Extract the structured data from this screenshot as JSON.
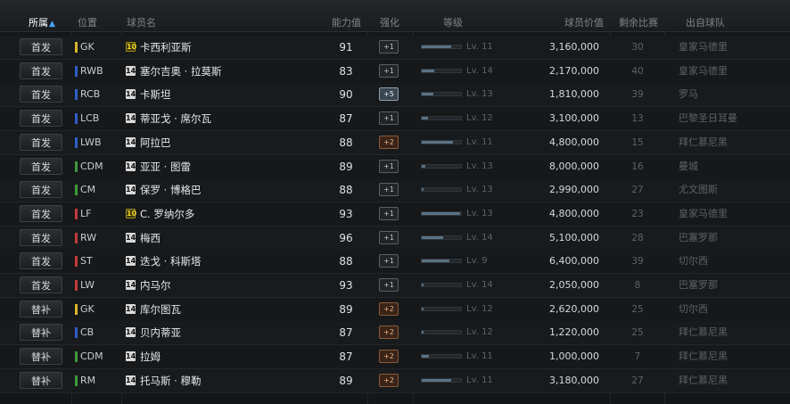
{
  "header": {
    "role": "所属",
    "position": "位置",
    "name": "球员名",
    "ability": "能力值",
    "enhance": "强化",
    "level": "等级",
    "value": "球员价值",
    "remaining": "剩余比赛",
    "team": "出自球队"
  },
  "rows": [
    {
      "role": "首发",
      "pos": "GK",
      "pos_color": "#d9b42a",
      "badge": "10",
      "name": "卡西利亚斯",
      "ability": "91",
      "enh": "+1",
      "enh_style": "grey",
      "lv_progress": 0.75,
      "level": "Lv. 11",
      "value": "3,160,000",
      "remaining": "30",
      "team": "皇家马德里"
    },
    {
      "role": "首发",
      "pos": "RWB",
      "pos_color": "#2f5fc9",
      "badge": "14",
      "name": "塞尔吉奥 · 拉莫斯",
      "ability": "83",
      "enh": "+1",
      "enh_style": "grey",
      "lv_progress": 0.32,
      "level": "Lv. 14",
      "value": "2,170,000",
      "remaining": "40",
      "team": "皇家马德里"
    },
    {
      "role": "首发",
      "pos": "RCB",
      "pos_color": "#2f5fc9",
      "badge": "14",
      "name": "卡斯坦",
      "ability": "90",
      "enh": "+5",
      "enh_style": "blue",
      "lv_progress": 0.3,
      "level": "Lv. 13",
      "value": "1,810,000",
      "remaining": "39",
      "team": "罗马"
    },
    {
      "role": "首发",
      "pos": "LCB",
      "pos_color": "#2f5fc9",
      "badge": "14",
      "name": "蒂亚戈 · 席尔瓦",
      "ability": "87",
      "enh": "+1",
      "enh_style": "grey",
      "lv_progress": 0.15,
      "level": "Lv. 12",
      "value": "3,100,000",
      "remaining": "13",
      "team": "巴黎圣日耳曼"
    },
    {
      "role": "首发",
      "pos": "LWB",
      "pos_color": "#2f5fc9",
      "badge": "14",
      "name": "阿拉巴",
      "ability": "88",
      "enh": "+2",
      "enh_style": "brown",
      "lv_progress": 0.8,
      "level": "Lv. 11",
      "value": "4,800,000",
      "remaining": "15",
      "team": "拜仁慕尼黑"
    },
    {
      "role": "首发",
      "pos": "CDM",
      "pos_color": "#3f9a3a",
      "badge": "14",
      "name": "亚亚 · 图雷",
      "ability": "89",
      "enh": "+1",
      "enh_style": "grey",
      "lv_progress": 0.1,
      "level": "Lv. 13",
      "value": "8,000,000",
      "remaining": "16",
      "team": "曼城"
    },
    {
      "role": "首发",
      "pos": "CM",
      "pos_color": "#3f9a3a",
      "badge": "14",
      "name": "保罗 · 博格巴",
      "ability": "88",
      "enh": "+1",
      "enh_style": "grey",
      "lv_progress": 0.05,
      "level": "Lv. 13",
      "value": "2,990,000",
      "remaining": "27",
      "team": "尤文图斯"
    },
    {
      "role": "首发",
      "pos": "LF",
      "pos_color": "#c23a3a",
      "badge": "10",
      "name": "C. 罗纳尔多",
      "ability": "93",
      "enh": "+1",
      "enh_style": "grey",
      "lv_progress": 0.98,
      "level": "Lv. 13",
      "value": "4,800,000",
      "remaining": "23",
      "team": "皇家马德里"
    },
    {
      "role": "首发",
      "pos": "RW",
      "pos_color": "#c23a3a",
      "badge": "14",
      "name": "梅西",
      "ability": "96",
      "enh": "+1",
      "enh_style": "grey",
      "lv_progress": 0.55,
      "level": "Lv. 14",
      "value": "5,100,000",
      "remaining": "28",
      "team": "巴塞罗那"
    },
    {
      "role": "首发",
      "pos": "ST",
      "pos_color": "#c23a3a",
      "badge": "14",
      "name": "迭戈 · 科斯塔",
      "ability": "88",
      "enh": "+1",
      "enh_style": "grey",
      "lv_progress": 0.7,
      "level": "Lv. 9",
      "value": "6,400,000",
      "remaining": "39",
      "team": "切尔西"
    },
    {
      "role": "首发",
      "pos": "LW",
      "pos_color": "#c23a3a",
      "badge": "14",
      "name": "内马尔",
      "ability": "93",
      "enh": "+1",
      "enh_style": "grey",
      "lv_progress": 0.04,
      "level": "Lv. 14",
      "value": "2,050,000",
      "remaining": "8",
      "team": "巴塞罗那"
    },
    {
      "role": "替补",
      "pos": "GK",
      "pos_color": "#d9b42a",
      "badge": "14",
      "name": "库尔图瓦",
      "ability": "89",
      "enh": "+2",
      "enh_style": "brown",
      "lv_progress": 0.04,
      "level": "Lv. 12",
      "value": "2,620,000",
      "remaining": "25",
      "team": "切尔西"
    },
    {
      "role": "替补",
      "pos": "CB",
      "pos_color": "#2f5fc9",
      "badge": "14",
      "name": "贝内蒂亚",
      "ability": "87",
      "enh": "+2",
      "enh_style": "brown",
      "lv_progress": 0.04,
      "level": "Lv. 12",
      "value": "1,220,000",
      "remaining": "25",
      "team": "拜仁慕尼黑"
    },
    {
      "role": "替补",
      "pos": "CDM",
      "pos_color": "#3f9a3a",
      "badge": "14",
      "name": "拉姆",
      "ability": "87",
      "enh": "+2",
      "enh_style": "brown",
      "lv_progress": 0.18,
      "level": "Lv. 11",
      "value": "1,000,000",
      "remaining": "7",
      "team": "拜仁慕尼黑"
    },
    {
      "role": "替补",
      "pos": "RM",
      "pos_color": "#3f9a3a",
      "badge": "14",
      "name": "托马斯 · 穆勒",
      "ability": "89",
      "enh": "+2",
      "enh_style": "brown",
      "lv_progress": 0.75,
      "level": "Lv. 11",
      "value": "3,180,000",
      "remaining": "27",
      "team": "拜仁慕尼黑"
    }
  ]
}
